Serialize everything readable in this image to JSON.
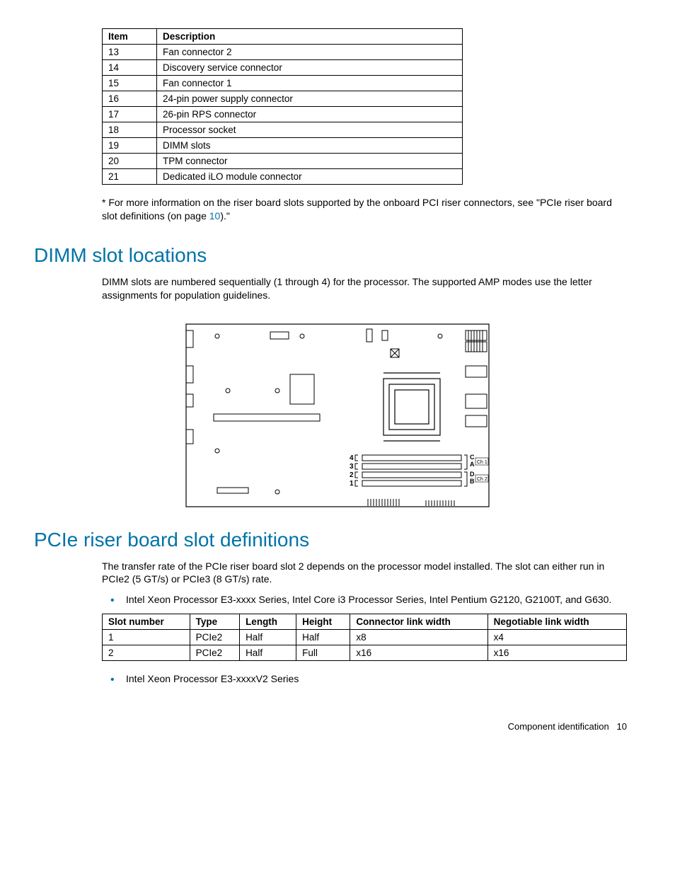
{
  "tables": {
    "components": {
      "headers": [
        "Item",
        "Description"
      ],
      "rows": [
        {
          "item": "13",
          "desc": "Fan connector 2"
        },
        {
          "item": "14",
          "desc": "Discovery service connector"
        },
        {
          "item": "15",
          "desc": "Fan connector 1"
        },
        {
          "item": "16",
          "desc": "24-pin power supply connector"
        },
        {
          "item": "17",
          "desc": "26-pin RPS connector"
        },
        {
          "item": "18",
          "desc": "Processor socket"
        },
        {
          "item": "19",
          "desc": "DIMM slots"
        },
        {
          "item": "20",
          "desc": "TPM connector"
        },
        {
          "item": "21",
          "desc": "Dedicated iLO module connector"
        }
      ]
    },
    "pcie": {
      "headers": [
        "Slot number",
        "Type",
        "Length",
        "Height",
        "Connector link width",
        "Negotiable link width"
      ],
      "rows": [
        {
          "slot": "1",
          "type": "PCIe2",
          "length": "Half",
          "height": "Half",
          "conn": "x8",
          "neg": "x4"
        },
        {
          "slot": "2",
          "type": "PCIe2",
          "length": "Half",
          "height": "Full",
          "conn": "x16",
          "neg": "x16"
        }
      ]
    }
  },
  "footnote": {
    "pre": "* For more information on the riser board slots supported by the onboard PCI riser connectors, see \"PCIe riser board slot definitions (on page ",
    "link": "10",
    "post": ").\""
  },
  "sections": {
    "dimm": {
      "title": "DIMM slot locations",
      "para": "DIMM slots are numbered sequentially (1 through 4) for the processor. The supported AMP modes use the letter assignments for population guidelines."
    },
    "pcie": {
      "title": "PCIe riser board slot definitions",
      "para": "The transfer rate of the PCIe riser board slot 2 depends on the processor model installed. The slot can either run in PCIe2 (5 GT/s) or PCIe3 (8 GT/s) rate.",
      "bullets": [
        "Intel Xeon Processor E3-xxxx Series, Intel Core i3 Processor Series, Intel Pentium G2120, G2100T, and G630.",
        "Intel Xeon Processor E3-xxxxV2 Series"
      ]
    }
  },
  "diagram": {
    "slot_nums": [
      "4",
      "3",
      "2",
      "1"
    ],
    "slot_letters": [
      "C",
      "A",
      "D",
      "B"
    ],
    "ch_labels": [
      "Ch 1",
      "Ch 2"
    ]
  },
  "footer": {
    "section": "Component identification",
    "page": "10"
  }
}
